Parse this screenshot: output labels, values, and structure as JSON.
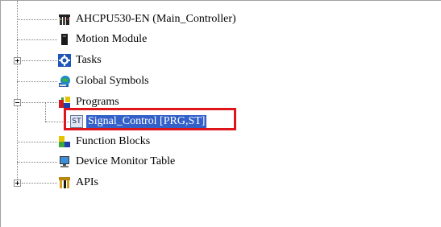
{
  "tree": {
    "controller": {
      "label": "AHCPU530-EN  (Main_Controller)",
      "icon": "cpu-icon"
    },
    "motion": {
      "label": "Motion Module",
      "icon": "module-icon"
    },
    "tasks": {
      "label": "Tasks",
      "icon": "gear-icon",
      "expander": "plus"
    },
    "globals": {
      "label": "Global Symbols",
      "icon": "globe-icon"
    },
    "programs": {
      "label": "Programs",
      "icon": "blocks-icon",
      "expander": "minus",
      "children": [
        {
          "label": "Signal_Control [PRG,ST]",
          "badge": "ST",
          "selected": true
        }
      ]
    },
    "function_blocks": {
      "label": "Function Blocks",
      "icon": "function-block-icon"
    },
    "device_monitor": {
      "label": "Device Monitor Table",
      "icon": "monitor-icon"
    },
    "apis": {
      "label": "APIs",
      "icon": "api-icon",
      "expander": "plus"
    }
  },
  "colors": {
    "selection": "#3361c9",
    "highlight_box": "#e0151b"
  }
}
